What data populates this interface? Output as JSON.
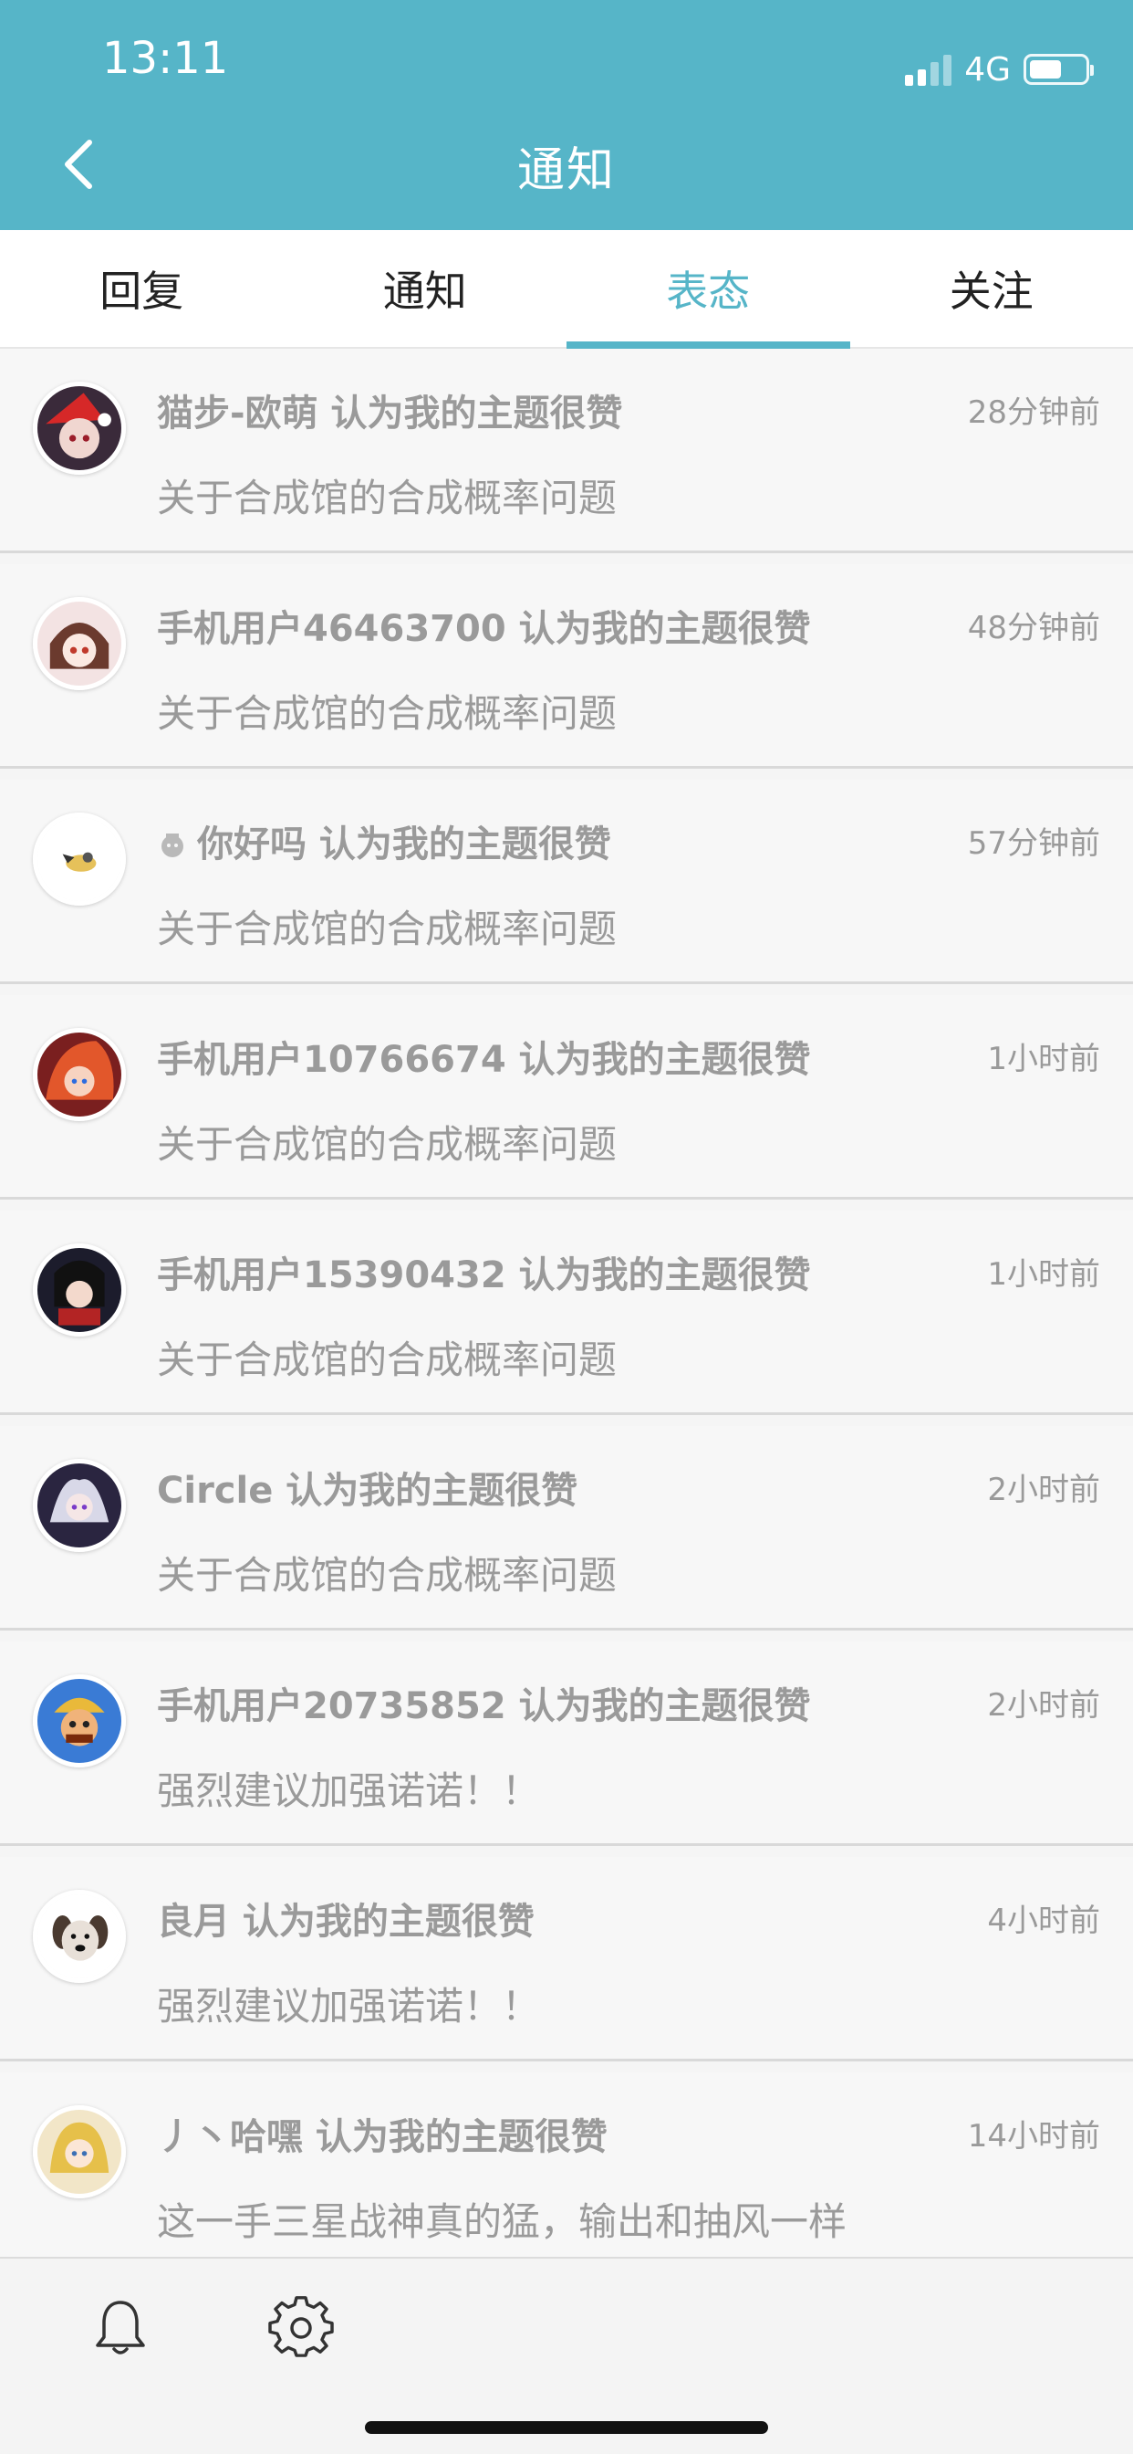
{
  "status_bar": {
    "time": "13:11",
    "network": "4G",
    "battery_level": 0.58,
    "signal_bars": 2
  },
  "header": {
    "title": "通知"
  },
  "tabs": [
    {
      "label": "回复",
      "active": false
    },
    {
      "label": "通知",
      "active": false
    },
    {
      "label": "表态",
      "active": true
    },
    {
      "label": "关注",
      "active": false
    }
  ],
  "items": [
    {
      "title": "猫步-欧萌 认为我的主题很赞",
      "time": "28分钟前",
      "topic": "关于合成馆的合成概率问题"
    },
    {
      "title": "手机用户46463700 认为我的主题很赞",
      "time": "48分钟前",
      "topic": "关于合成馆的合成概率问题"
    },
    {
      "title": "你好吗 认为我的主题很赞",
      "time": "57分钟前",
      "topic": "关于合成馆的合成概率问题"
    },
    {
      "title": "手机用户10766674 认为我的主题很赞",
      "time": "1小时前",
      "topic": "关于合成馆的合成概率问题"
    },
    {
      "title": "手机用户15390432 认为我的主题很赞",
      "time": "1小时前",
      "topic": "关于合成馆的合成概率问题"
    },
    {
      "title": "Circle 认为我的主题很赞",
      "time": "2小时前",
      "topic": "关于合成馆的合成概率问题"
    },
    {
      "title": "手机用户20735852 认为我的主题很赞",
      "time": "2小时前",
      "topic": "强烈建议加强诺诺！！"
    },
    {
      "title": "良月 认为我的主题很赞",
      "time": "4小时前",
      "topic": "强烈建议加强诺诺！！"
    },
    {
      "title": "丿丶哈嘿 认为我的主题很赞",
      "time": "14小时前",
      "topic": "这一手三星战神真的猛，输出和抽风一样"
    }
  ],
  "colors": {
    "accent": "#56b5c8",
    "text_muted": "#9a9a9a"
  }
}
